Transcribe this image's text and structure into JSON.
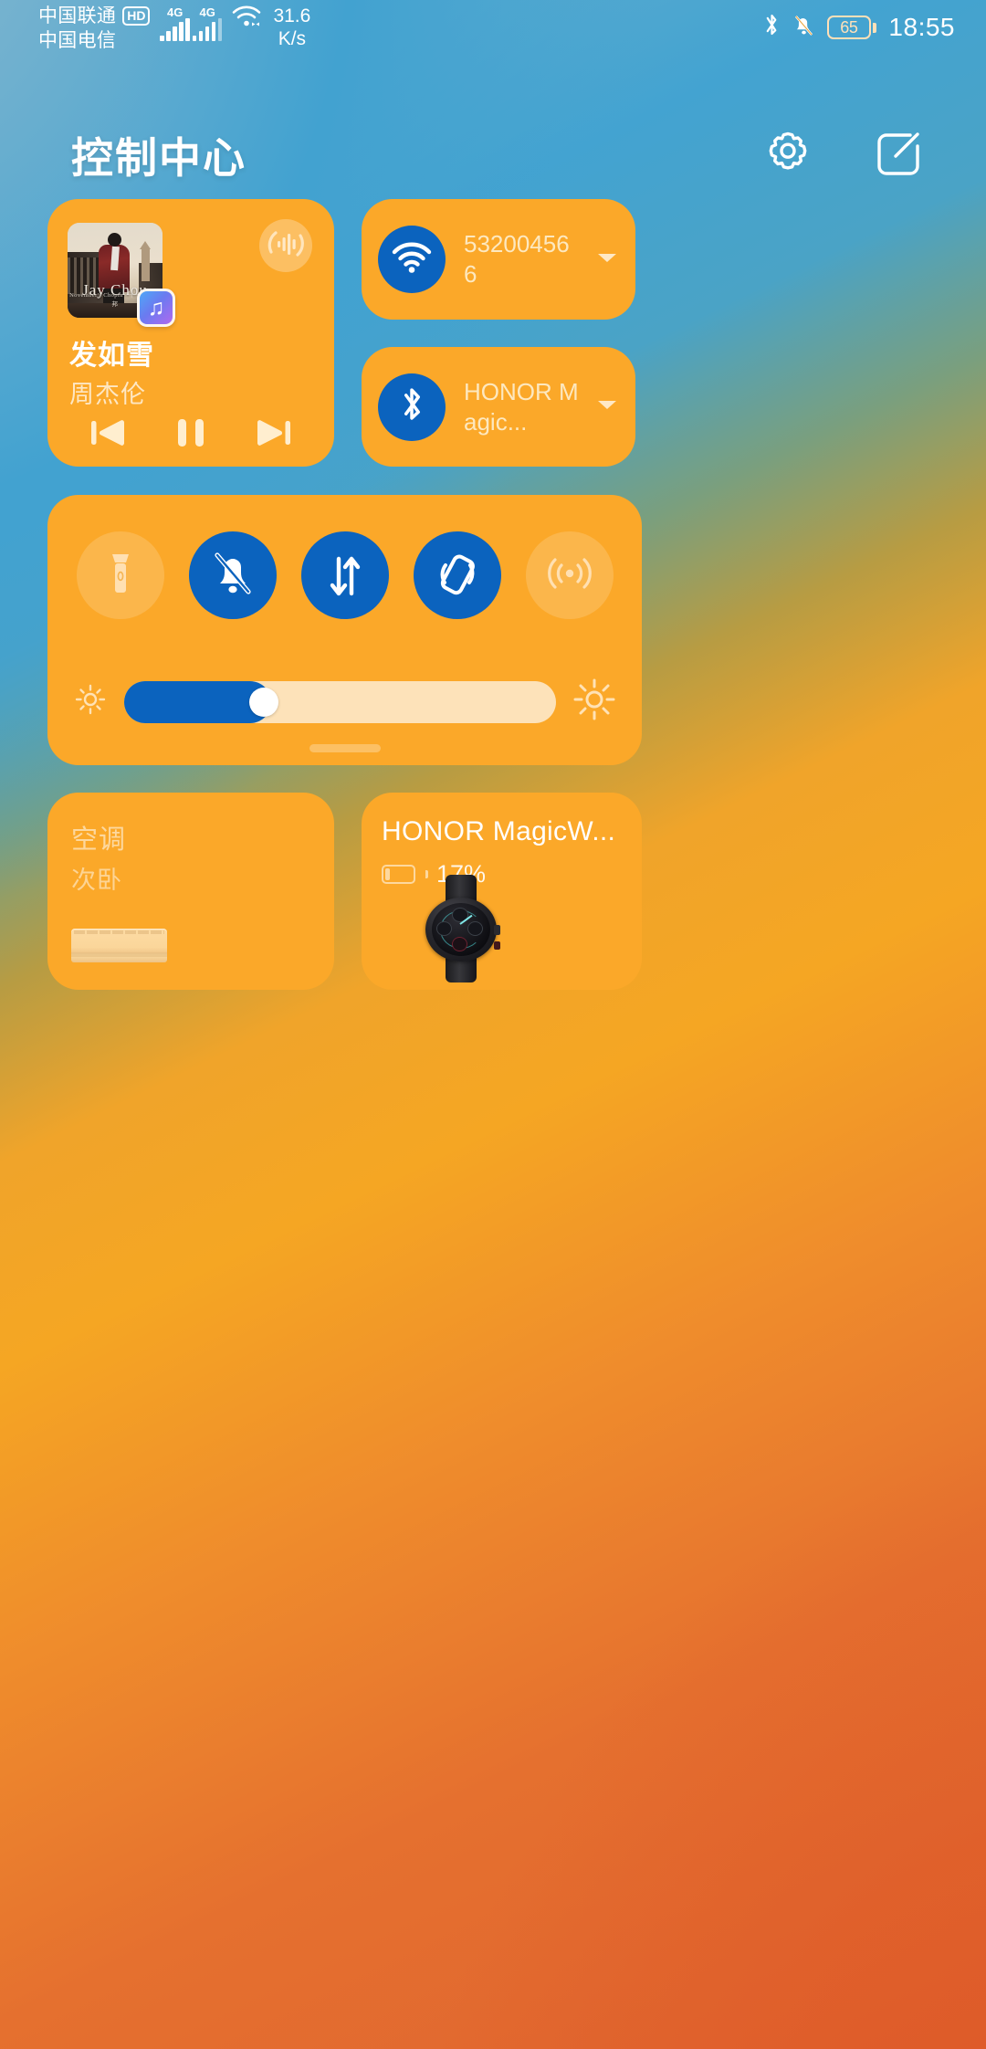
{
  "status_bar": {
    "carrier_primary": "中国联通",
    "carrier_primary_badge": "HD",
    "carrier_secondary": "中国电信",
    "signal_1_label": "4G",
    "signal_2_label": "4G",
    "wifi_icon": "wifi-icon",
    "network_speed_value": "31.6",
    "network_speed_unit": "K/s",
    "bluetooth_icon": "bluetooth-icon",
    "silent_icon": "bell-muted-icon",
    "battery_percent": "65",
    "time": "18:55"
  },
  "header": {
    "title": "控制中心",
    "settings_icon": "gear-icon",
    "edit_icon": "edit-square-icon"
  },
  "music": {
    "song_title": "发如雪",
    "artist": "周杰伦",
    "album_art_text": "Jay Chou",
    "album_art_subtext": "November's Chopin · 十一月的萧邦",
    "app_badge_icon": "music-note-icon",
    "cast_icon": "audio-output-icon",
    "prev_icon": "previous-track-icon",
    "play_pause_icon": "pause-icon",
    "next_icon": "next-track-icon",
    "state": "playing"
  },
  "wifi": {
    "icon": "wifi-icon",
    "ssid": "532004566",
    "enabled": true,
    "chevron_icon": "chevron-down-icon",
    "active_color": "#0b63be"
  },
  "bluetooth": {
    "icon": "bluetooth-icon",
    "device": "HONOR Magic...",
    "enabled": true,
    "chevron_icon": "chevron-down-icon",
    "active_color": "#0b63be"
  },
  "toggles": [
    {
      "name": "flashlight",
      "icon": "flashlight-icon",
      "state": "off"
    },
    {
      "name": "silent-mode",
      "icon": "bell-muted-icon",
      "state": "on"
    },
    {
      "name": "mobile-data",
      "icon": "data-transfer-icon",
      "state": "on"
    },
    {
      "name": "auto-rotate",
      "icon": "rotate-lock-icon",
      "state": "on"
    },
    {
      "name": "hotspot",
      "icon": "hotspot-icon",
      "state": "off"
    }
  ],
  "brightness": {
    "low_icon": "brightness-low-icon",
    "high_icon": "brightness-high-icon",
    "value_percent": 34
  },
  "expand_handle": "drag-handle",
  "air_conditioner": {
    "title": "空调",
    "room": "次卧",
    "state": "off",
    "device_image": "air-conditioner-image"
  },
  "watch": {
    "name": "HONOR MagicW...",
    "battery_percent": "17%",
    "battery_fill": 17,
    "device_image": "smartwatch-image"
  },
  "colors": {
    "card_bg": "#fba829",
    "accent_active": "#0b63be",
    "text_on_card": "#ffffff",
    "label_cream": "#fde8bf"
  }
}
